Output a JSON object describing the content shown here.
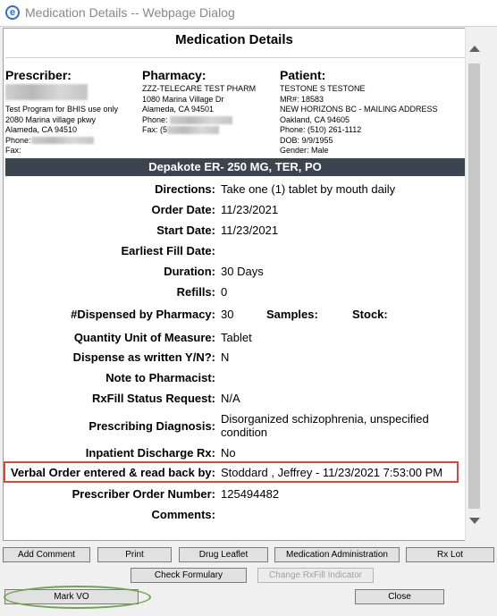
{
  "window": {
    "title": "Medication Details -- Webpage Dialog",
    "icon": "ie-icon"
  },
  "page": {
    "title": "Medication Details"
  },
  "prescriber": {
    "heading": "Prescriber:",
    "lines": [
      "Test Program for BHIS use only",
      "2080 Marina village pkwy",
      "Alameda, CA 94510"
    ],
    "phone_label": "Phone:",
    "fax_label": "Fax:"
  },
  "pharmacy": {
    "heading": "Pharmacy:",
    "lines": [
      "ZZZ-TELECARE TEST PHARM",
      "1080 Marina Village Dr",
      "Alameda, CA 94501"
    ],
    "phone_label": "Phone:",
    "fax_label": "Fax: (5"
  },
  "patient": {
    "heading": "Patient:",
    "lines": [
      "TESTONE S TESTONE",
      "MR#: 18583",
      "NEW HORIZONS BC - MAILING ADDRESS",
      "Oakland, CA 94605",
      "Phone: (510) 261-1112",
      "DOB: 9/9/1955",
      "Gender: Male"
    ]
  },
  "drug": {
    "name": "Depakote ER- 250 MG, TER, PO"
  },
  "details": {
    "directions": {
      "label": "Directions:",
      "value": "Take one (1) tablet by mouth daily"
    },
    "order_date": {
      "label": "Order Date:",
      "value": "11/23/2021"
    },
    "start_date": {
      "label": "Start Date:",
      "value": "11/23/2021"
    },
    "earliest_fill": {
      "label": "Earliest Fill Date:",
      "value": ""
    },
    "duration": {
      "label": "Duration:",
      "value": "30 Days"
    },
    "refills": {
      "label": "Refills:",
      "value": "0"
    },
    "dispensed": {
      "label": "#Dispensed by Pharmacy:",
      "value": "30",
      "samples_label": "Samples:",
      "stock_label": "Stock:"
    },
    "qty_unit": {
      "label": "Quantity Unit of Measure:",
      "value": "Tablet"
    },
    "daw": {
      "label": "Dispense as written Y/N?:",
      "value": "N"
    },
    "note": {
      "label": "Note to Pharmacist:",
      "value": ""
    },
    "rxfill": {
      "label": "RxFill Status Request:",
      "value": "N/A"
    },
    "diagnosis": {
      "label": "Prescribing Diagnosis:",
      "value": "Disorganized schizophrenia, unspecified condition"
    },
    "inpatient": {
      "label": "Inpatient Discharge Rx:",
      "value": "No"
    },
    "verbal": {
      "label": "Verbal Order entered & read back by:",
      "value": "Stoddard , Jeffrey - 11/23/2021 7:53:00 PM"
    },
    "order_number": {
      "label": "Prescriber Order Number:",
      "value": "125494482"
    },
    "comments": {
      "label": "Comments:",
      "value": ""
    }
  },
  "buttons": {
    "add_comment": "Add Comment",
    "print": "Print",
    "drug_leaflet": "Drug Leaflet",
    "med_admin": "Medication Administration",
    "rx_lot": "Rx Lot",
    "check_formulary": "Check Formulary",
    "change_rxfill": "Change RxFill Indicator",
    "mark_vo": "Mark VO",
    "close": "Close"
  },
  "colors": {
    "highlight": "#d9463a",
    "annotation_ellipse": "#6aa84f",
    "drug_bar": "#3a4550"
  }
}
